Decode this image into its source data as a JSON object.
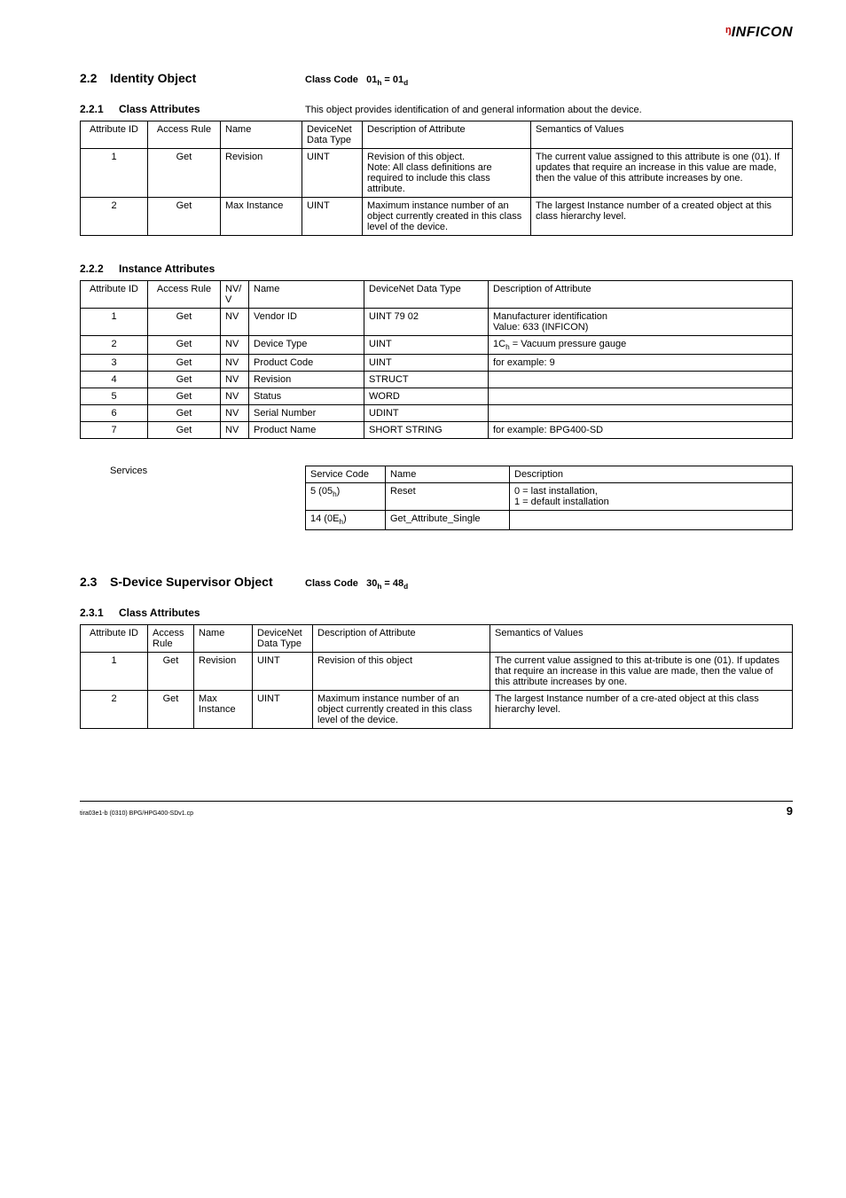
{
  "brand": "INFICON",
  "s22": {
    "num": "2.2",
    "title": "Identity Object",
    "class_code": "Class Code   01ₕ = 01_d"
  },
  "s221": {
    "num": "2.2.1",
    "title": "Class Attributes",
    "desc": "This object provides identification of and general information about the device."
  },
  "t221": {
    "head": [
      "Attribute ID",
      "Access Rule",
      "Name",
      "DeviceNet Data Type",
      "Description of Attribute",
      "Semantics of Values"
    ],
    "rows": [
      {
        "id": "1",
        "access": "Get",
        "name": "Revision",
        "dt": "UINT",
        "desc": "Revision of this object.\nNote: All class definitions are required to include this class attribute.",
        "sem": "The current value assigned to this attribute is one (01). If updates that require an increase in this value are made, then the value of this attribute increases by one."
      },
      {
        "id": "2",
        "access": "Get",
        "name": "Max Instance",
        "dt": "UINT",
        "desc": "Maximum instance number of an object currently created in this class level of the device.",
        "sem": "The largest Instance number of a created object at this class hierarchy level."
      }
    ]
  },
  "s222": {
    "num": "2.2.2",
    "title": "Instance Attributes"
  },
  "t222": {
    "head": [
      "Attribute ID",
      "Access Rule",
      "NV/\nV",
      "Name",
      "DeviceNet Data Type",
      "Description of Attribute"
    ],
    "rows": [
      {
        "id": "1",
        "access": "Get",
        "nv": "NV",
        "name": "Vendor ID",
        "dt": "UINT  79 02",
        "desc": "Manufacturer identification\nValue: 633 (INFICON)"
      },
      {
        "id": "2",
        "access": "Get",
        "nv": "NV",
        "name": "Device Type",
        "dt": "UINT",
        "desc": "1Cₕ = Vacuum pressure gauge"
      },
      {
        "id": "3",
        "access": "Get",
        "nv": "NV",
        "name": "Product Code",
        "dt": "UINT",
        "desc": "for example: 9"
      },
      {
        "id": "4",
        "access": "Get",
        "nv": "NV",
        "name": "Revision",
        "dt": "STRUCT",
        "desc": ""
      },
      {
        "id": "5",
        "access": "Get",
        "nv": "NV",
        "name": "Status",
        "dt": "WORD",
        "desc": ""
      },
      {
        "id": "6",
        "access": "Get",
        "nv": "NV",
        "name": "Serial Number",
        "dt": "UDINT",
        "desc": ""
      },
      {
        "id": "7",
        "access": "Get",
        "nv": "NV",
        "name": "Product Name",
        "dt": "SHORT STRING",
        "desc": "for example: BPG400-SD"
      }
    ]
  },
  "services": {
    "label": "Services",
    "head": [
      "Service Code",
      "Name",
      "Description"
    ],
    "rows": [
      {
        "code": "5 (05ₕ)",
        "name": "Reset",
        "desc": "0 = last installation,\n1 = default installation"
      },
      {
        "code": "14 (0Eₕ)",
        "name": "Get_Attribute_Single",
        "desc": ""
      }
    ]
  },
  "s23": {
    "num": "2.3",
    "title": "S-Device Supervisor Object",
    "class_code": "Class Code   30ₕ = 48_d"
  },
  "s231": {
    "num": "2.3.1",
    "title": "Class Attributes"
  },
  "t231": {
    "head": [
      "Attribute ID",
      "Access Rule",
      "Name",
      "DeviceNet Data Type",
      "Description of Attribute",
      "Semantics of Values"
    ],
    "rows": [
      {
        "id": "1",
        "access": "Get",
        "name": "Revision",
        "dt": "UINT",
        "desc": "Revision of this object",
        "sem": "The current value assigned to this at-tribute is one (01). If updates that require an increase in this value are made, then the value of this attribute increases by one."
      },
      {
        "id": "2",
        "access": "Get",
        "name": "Max Instance",
        "dt": "UINT",
        "desc": "Maximum instance number of an object currently created in this class level of the device.",
        "sem": "The largest Instance number of a cre-ated object at this class hierarchy level."
      }
    ]
  },
  "footer": {
    "left": "tira03e1-b   (0310)   BPG/HPG400-SDv1.cp",
    "page": "9"
  }
}
